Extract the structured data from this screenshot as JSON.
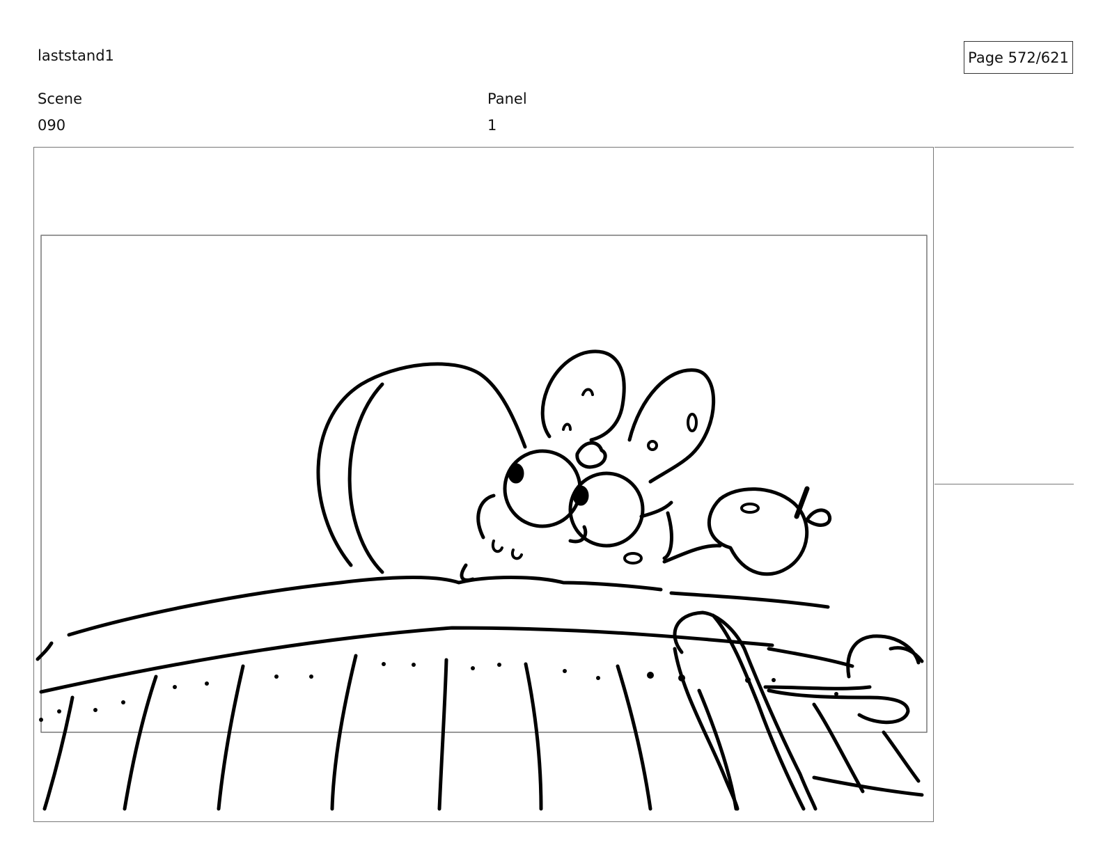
{
  "header": {
    "project_title": "laststand1",
    "page_indicator": "Page 572/621"
  },
  "fields": {
    "scene_label": "Scene",
    "scene_value": "090",
    "panel_label": "Panel",
    "panel_value": "1"
  },
  "panel": {
    "drawing": "storyboard-sketch"
  }
}
